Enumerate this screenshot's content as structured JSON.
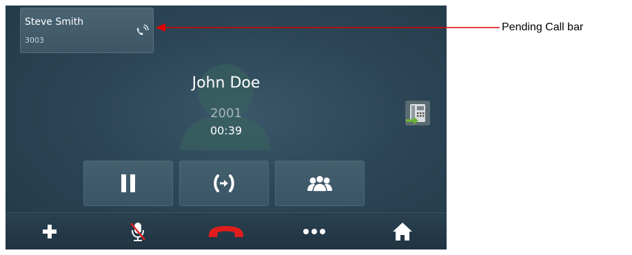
{
  "pending_call": {
    "name": "Steve Smith",
    "number": "3003",
    "icon": "incoming-call-icon"
  },
  "active_call": {
    "caller_name": "John Doe",
    "caller_number": "2001",
    "duration": "00:39"
  },
  "side_icons": {
    "transfer": "phone-transfer-icon"
  },
  "action_buttons": [
    {
      "name": "hold",
      "icon": "pause-icon"
    },
    {
      "name": "transfer-call",
      "icon": "transfer-arrows-icon"
    },
    {
      "name": "conference",
      "icon": "conference-icon"
    }
  ],
  "bottom_bar": [
    {
      "name": "add-call",
      "icon": "plus-icon"
    },
    {
      "name": "mute",
      "icon": "muted-microphone-icon"
    },
    {
      "name": "end-call",
      "icon": "hang-up-icon"
    },
    {
      "name": "more",
      "icon": "more-dots-icon"
    },
    {
      "name": "home",
      "icon": "home-icon"
    }
  ],
  "annotation": {
    "label": "Pending Call bar",
    "color": "#e00000"
  },
  "colors": {
    "screen_bg": "#2c4657",
    "hang_up": "#e21c1c",
    "transfer_green": "#6ab23b"
  }
}
